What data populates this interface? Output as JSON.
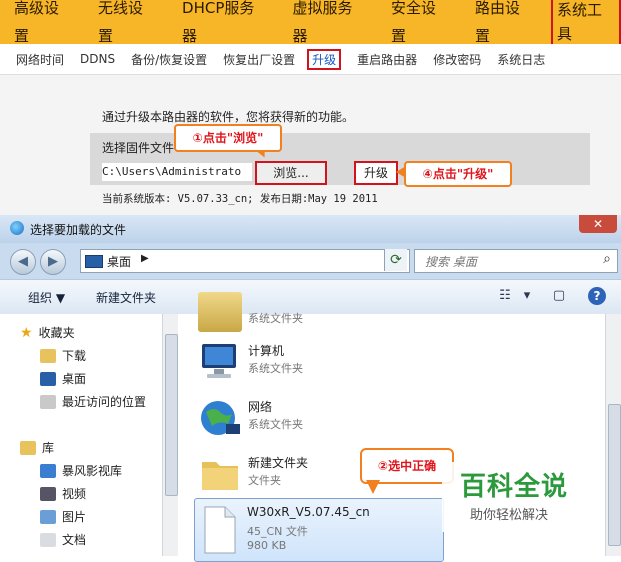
{
  "router": {
    "top_nav": [
      "高级设置",
      "无线设置",
      "DHCP服务器",
      "虚拟服务器",
      "安全设置",
      "路由设置",
      "系统工具"
    ],
    "top_nav_selected": "系统工具",
    "sub_nav": [
      "网络时间",
      "DDNS",
      "备份/恢复设置",
      "恢复出厂设置",
      "升级",
      "重启路由器",
      "修改密码",
      "系统日志"
    ],
    "sub_nav_selected": "升级",
    "intro": "通过升级本路由器的软件，您将获得新的功能。",
    "firmware_label": "选择固件文件",
    "file_path": "C:\\Users\\Administrato",
    "browse_label": "浏览...",
    "upgrade_label": "升级",
    "version_text": "当前系统版本: V5.07.33_cn; 发布日期:May 19 2011"
  },
  "callouts": {
    "step1": "①点击\"浏览\"",
    "step4": "④点击\"升级\"",
    "step2": "②选中正确"
  },
  "dialog": {
    "title": "选择要加载的文件",
    "close": "✕",
    "location": "桌面",
    "search_placeholder": "搜索 桌面",
    "organize": "组织 ▼",
    "new_folder": "新建文件夹",
    "nav": {
      "favorites": "收藏夹",
      "downloads": "下载",
      "desktop": "桌面",
      "recent": "最近访问的位置",
      "libraries": "库",
      "storm": "暴风影视库",
      "videos": "视频",
      "pictures": "图片",
      "documents": "文档"
    },
    "files": [
      {
        "name": "",
        "type": "系统文件夹",
        "size": ""
      },
      {
        "name": "计算机",
        "type": "系统文件夹",
        "size": ""
      },
      {
        "name": "网络",
        "type": "系统文件夹",
        "size": ""
      },
      {
        "name": "新建文件夹",
        "type": "文件夹",
        "size": ""
      },
      {
        "name": "W30xR_V5.07.45_cn",
        "type": "45_CN 文件",
        "size": "980 KB"
      }
    ]
  },
  "watermark": {
    "logo": "百科全说",
    "slogan": "助你轻松解决"
  },
  "colors": {
    "nav_bg": "#f7b628",
    "highlight_red": "#d1141b",
    "callout_border": "#f08020",
    "watermark_green": "#2b9a3c"
  }
}
